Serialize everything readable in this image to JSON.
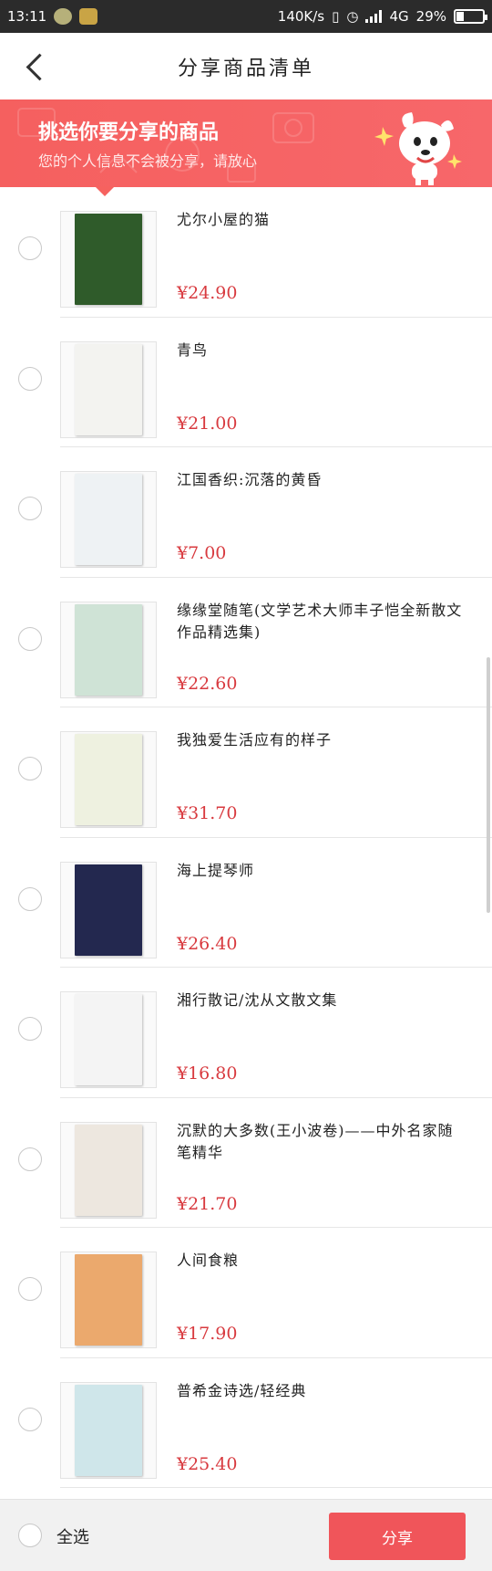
{
  "status_bar": {
    "time": "13:11",
    "net_speed": "140K/s",
    "network": "4G",
    "battery": "29%",
    "battery_level": 0.29
  },
  "header": {
    "title": "分享商品清单"
  },
  "banner": {
    "title": "挑选你要分享的商品",
    "subtitle": "您的个人信息不会被分享，请放心"
  },
  "products": [
    {
      "title": "尤尔小屋的猫",
      "price": "¥24.90",
      "cover_color": "#2f5b2a"
    },
    {
      "title": "青鸟",
      "price": "¥21.00",
      "cover_color": "#f3f3f0"
    },
    {
      "title": "江国香织:沉落的黄昏",
      "price": "¥7.00",
      "cover_color": "#eef2f4"
    },
    {
      "title": "缘缘堂随笔(文学艺术大师丰子恺全新散文作品精选集)",
      "price": "¥22.60",
      "cover_color": "#cfe3d6"
    },
    {
      "title": "我独爱生活应有的样子",
      "price": "¥31.70",
      "cover_color": "#eef1e0"
    },
    {
      "title": "海上提琴师",
      "price": "¥26.40",
      "cover_color": "#23284f"
    },
    {
      "title": "湘行散记/沈从文散文集",
      "price": "¥16.80",
      "cover_color": "#f4f4f4"
    },
    {
      "title": "沉默的大多数(王小波卷)——中外名家随笔精华",
      "price": "¥21.70",
      "cover_color": "#ede7df"
    },
    {
      "title": "人间食粮",
      "price": "¥17.90",
      "cover_color": "#eba96d"
    },
    {
      "title": "普希金诗选/轻经典",
      "price": "¥25.40",
      "cover_color": "#cfe6ea"
    }
  ],
  "bottom": {
    "select_all_label": "全选",
    "share_label": "分享"
  }
}
